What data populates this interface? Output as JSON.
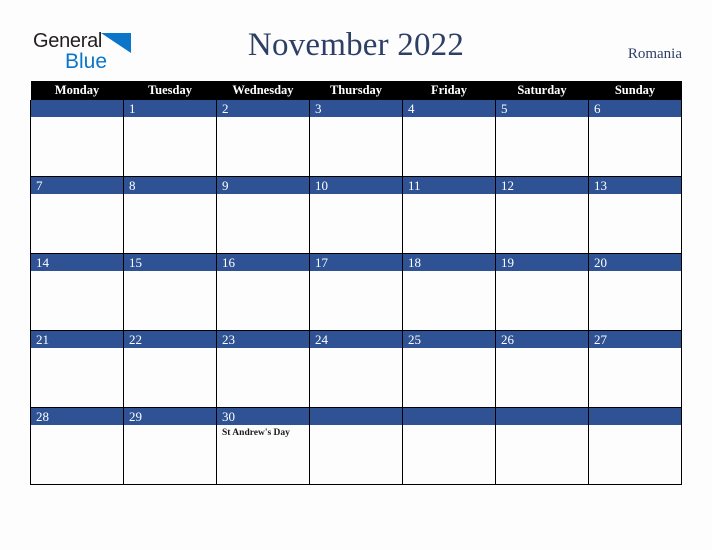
{
  "brand": {
    "name_part1": "General",
    "name_part2": "Blue",
    "triangle_icon": "triangle-icon",
    "accent_color": "#0b75c9",
    "text_color": "#231f20"
  },
  "header": {
    "title": "November 2022",
    "country": "Romania",
    "title_color": "#2e3f66"
  },
  "calendar": {
    "weekday_headers": [
      "Monday",
      "Tuesday",
      "Wednesday",
      "Thursday",
      "Friday",
      "Saturday",
      "Sunday"
    ],
    "header_bg": "#000000",
    "daybar_bg": "#2e5293",
    "daybar_text": "#ffffff",
    "cell_bg": "#fdfdfd",
    "border_color": "#000000",
    "weeks": [
      [
        {
          "day": "",
          "event": ""
        },
        {
          "day": "1",
          "event": ""
        },
        {
          "day": "2",
          "event": ""
        },
        {
          "day": "3",
          "event": ""
        },
        {
          "day": "4",
          "event": ""
        },
        {
          "day": "5",
          "event": ""
        },
        {
          "day": "6",
          "event": ""
        }
      ],
      [
        {
          "day": "7",
          "event": ""
        },
        {
          "day": "8",
          "event": ""
        },
        {
          "day": "9",
          "event": ""
        },
        {
          "day": "10",
          "event": ""
        },
        {
          "day": "11",
          "event": ""
        },
        {
          "day": "12",
          "event": ""
        },
        {
          "day": "13",
          "event": ""
        }
      ],
      [
        {
          "day": "14",
          "event": ""
        },
        {
          "day": "15",
          "event": ""
        },
        {
          "day": "16",
          "event": ""
        },
        {
          "day": "17",
          "event": ""
        },
        {
          "day": "18",
          "event": ""
        },
        {
          "day": "19",
          "event": ""
        },
        {
          "day": "20",
          "event": ""
        }
      ],
      [
        {
          "day": "21",
          "event": ""
        },
        {
          "day": "22",
          "event": ""
        },
        {
          "day": "23",
          "event": ""
        },
        {
          "day": "24",
          "event": ""
        },
        {
          "day": "25",
          "event": ""
        },
        {
          "day": "26",
          "event": ""
        },
        {
          "day": "27",
          "event": ""
        }
      ],
      [
        {
          "day": "28",
          "event": ""
        },
        {
          "day": "29",
          "event": ""
        },
        {
          "day": "30",
          "event": "St Andrew's Day"
        },
        {
          "day": "",
          "event": ""
        },
        {
          "day": "",
          "event": ""
        },
        {
          "day": "",
          "event": ""
        },
        {
          "day": "",
          "event": ""
        }
      ]
    ]
  }
}
